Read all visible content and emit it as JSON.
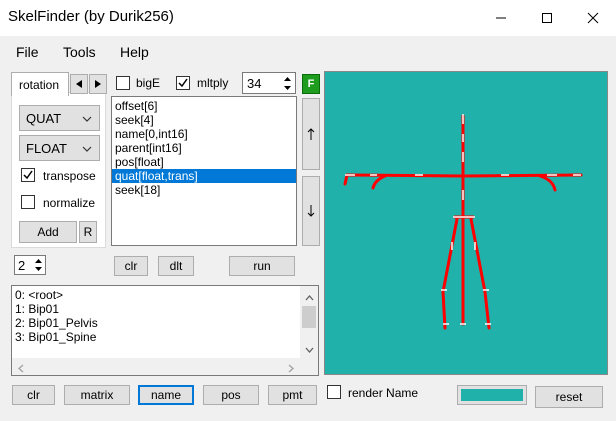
{
  "window": {
    "title": "SkelFinder (by Durik256)"
  },
  "menu": {
    "file": "File",
    "tools": "Tools",
    "help": "Help"
  },
  "tab": {
    "label": "rotation"
  },
  "options": {
    "bigE_label": "bigE",
    "bigE_checked": false,
    "mltply_label": "mltply",
    "mltply_checked": true,
    "mltply_value": "34",
    "f_label": "F"
  },
  "combos": {
    "rotation_format": "QUAT",
    "data_type": "FLOAT"
  },
  "checks": {
    "transpose_label": "transpose",
    "transpose_checked": true,
    "normalize_label": "normalize",
    "normalize_checked": false
  },
  "buttons": {
    "add": "Add",
    "r": "R",
    "clr": "clr",
    "dlt": "dlt",
    "run": "run",
    "clr2": "clr",
    "matrix": "matrix",
    "name": "name",
    "pos": "pos",
    "pmt": "pmt",
    "reset": "reset"
  },
  "command_list": {
    "items": [
      "offset[6]",
      "seek[4]",
      "name[0,int16]",
      "parent[int16]",
      "pos[float]",
      "quat[float,trans]",
      "seek[18]"
    ],
    "selected_index": 5
  },
  "level_spinner": {
    "value": "2"
  },
  "bones_list": {
    "items": [
      "0: <root>",
      "1: Bip01",
      "2: Bip01_Pelvis",
      "3: Bip01_Spine"
    ]
  },
  "render_name": {
    "label": "render Name",
    "checked": false
  },
  "colors": {
    "viewport_bg": "#20b2aa",
    "bone": "#ff0000",
    "joint": "#ffffff",
    "swatch": "#20b2aa",
    "f_button": "#1e9c1e"
  }
}
